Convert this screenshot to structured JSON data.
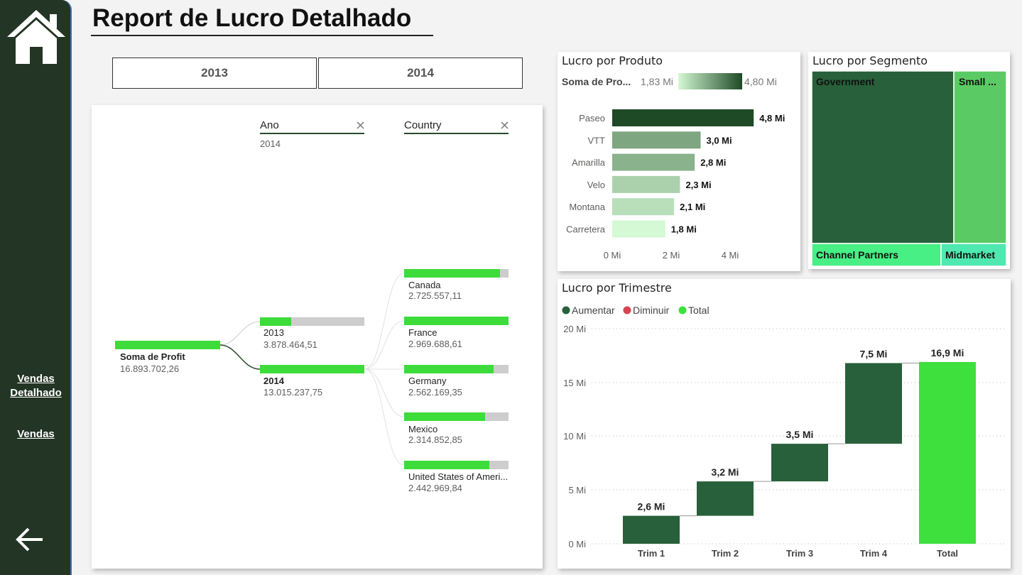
{
  "page": {
    "title": "Report de Lucro Detalhado"
  },
  "nav": {
    "vendas_detalhado_line1": "Vendas",
    "vendas_detalhado_line2": "Detalhado",
    "vendas": "Vendas"
  },
  "year_buttons": {
    "btn_2013": "2013",
    "btn_2014": "2014"
  },
  "decomp_tree": {
    "ano_header": "Ano",
    "ano_value": "2014",
    "country_header": "Country",
    "root_label": "Soma de Profit",
    "root_value": "16.893.702,26",
    "years": [
      {
        "label": "2013",
        "value": "3.878.464,51",
        "fraction": 0.3
      },
      {
        "label": "2014",
        "value": "13.015.237,75",
        "fraction": 1.0
      }
    ],
    "countries": [
      {
        "label": "Canada",
        "value": "2.725.557,11",
        "fraction": 0.92
      },
      {
        "label": "France",
        "value": "2.969.688,61",
        "fraction": 1.0
      },
      {
        "label": "Germany",
        "value": "2.562.169,35",
        "fraction": 0.86
      },
      {
        "label": "Mexico",
        "value": "2.314.852,85",
        "fraction": 0.78
      },
      {
        "label": "United States of Ameri...",
        "value": "2.442.969,84",
        "fraction": 0.82
      }
    ]
  },
  "produto": {
    "title": "Lucro por Produto",
    "legend_label": "Soma de Pro...",
    "legend_min": "1,83 Mi",
    "legend_max": "4,80 Mi",
    "axis_ticks": [
      "0 Mi",
      "2 Mi",
      "4 Mi"
    ],
    "colors": {
      "low": "#d4f9d4",
      "high": "#1e4a26"
    }
  },
  "segmento": {
    "title": "Lucro por Segmento",
    "tiles": [
      "Government",
      "Small ...",
      "Channel Partners",
      "Midmarket"
    ],
    "colors": [
      "#27603a",
      "#5acb64",
      "#47ef84",
      "#4ee8b0"
    ]
  },
  "trimestre": {
    "title": "Lucro por Trimestre",
    "legend": [
      {
        "label": "Aumentar",
        "color": "#27603a"
      },
      {
        "label": "Diminuir",
        "color": "#d64550"
      },
      {
        "label": "Total",
        "color": "#3ee03e"
      }
    ],
    "y_ticks": [
      "20 Mi",
      "15 Mi",
      "10 Mi",
      "5 Mi",
      "0 Mi"
    ]
  },
  "chart_data": [
    {
      "type": "bar",
      "title": "Lucro por Produto",
      "orientation": "horizontal",
      "categories": [
        "Paseo",
        "VTT",
        "Amarilla",
        "Velo",
        "Montana",
        "Carretera"
      ],
      "values": [
        4.8,
        3.0,
        2.8,
        2.3,
        2.1,
        1.8
      ],
      "data_labels": [
        "4,8 Mi",
        "3,0 Mi",
        "2,8 Mi",
        "2,3 Mi",
        "2,1 Mi",
        "1,8 Mi"
      ],
      "xlim": [
        0,
        4.8
      ],
      "unit": "Mi"
    },
    {
      "type": "bar",
      "title": "Lucro por Trimestre",
      "subtype": "waterfall",
      "categories": [
        "Trim 1",
        "Trim 2",
        "Trim 3",
        "Trim 4",
        "Total"
      ],
      "values": [
        2.6,
        3.2,
        3.5,
        7.5,
        16.9
      ],
      "data_labels": [
        "2,6 Mi",
        "3,2 Mi",
        "3,5 Mi",
        "7,5 Mi",
        "16,9 Mi"
      ],
      "ylim": [
        0,
        20
      ],
      "unit": "Mi"
    }
  ]
}
